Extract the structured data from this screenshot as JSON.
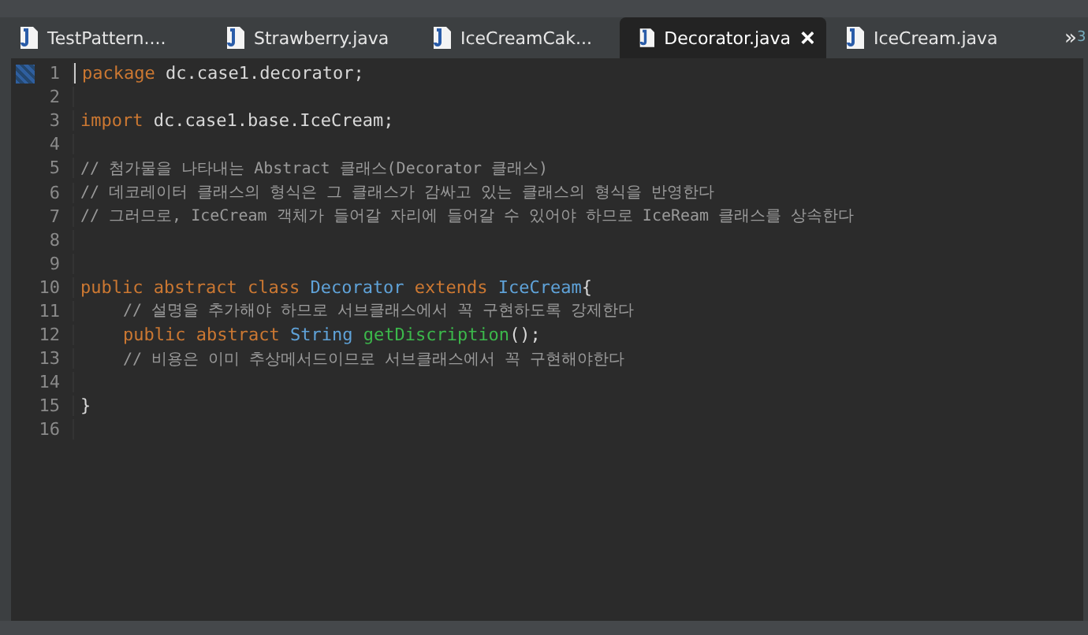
{
  "tabs": [
    {
      "label": "TestPattern....",
      "selected": false
    },
    {
      "label": "Strawberry.java",
      "selected": false
    },
    {
      "label": "IceCreamCak...",
      "selected": false
    },
    {
      "label": "Decorator.java",
      "selected": true
    },
    {
      "label": "IceCream.java",
      "selected": false
    }
  ],
  "overflow": {
    "glyph": "»",
    "count": "3"
  },
  "editor": {
    "lines": [
      {
        "number": "1",
        "current": true,
        "tokens": [
          {
            "kind": "keyword",
            "text": "package"
          },
          {
            "kind": "plain",
            "text": " dc.case1.decorator;"
          }
        ]
      },
      {
        "number": "2",
        "current": false
      },
      {
        "number": "3",
        "current": false,
        "tokens": [
          {
            "kind": "keyword",
            "text": "import"
          },
          {
            "kind": "plain",
            "text": " dc.case1.base.IceCream;"
          }
        ]
      },
      {
        "number": "4",
        "current": false
      },
      {
        "number": "5",
        "current": false,
        "tokens": [
          {
            "kind": "comment",
            "text": "// 첨가물을 나타내는 Abstract 클래스(Decorator 클래스)"
          }
        ]
      },
      {
        "number": "6",
        "current": false,
        "tokens": [
          {
            "kind": "comment",
            "text": "// 데코레이터 클래스의 형식은 그 클래스가 감싸고 있는 클래스의 형식을 반영한다"
          }
        ]
      },
      {
        "number": "7",
        "current": false,
        "tokens": [
          {
            "kind": "comment",
            "text": "// 그러므로, IceCream 객체가 들어갈 자리에 들어갈 수 있어야 하므로 IceReam 클래스를 상속한다"
          }
        ]
      },
      {
        "number": "8",
        "current": false
      },
      {
        "number": "9",
        "current": false
      },
      {
        "number": "10",
        "current": false,
        "tokens": [
          {
            "kind": "keyword",
            "text": "public abstract class "
          },
          {
            "kind": "type",
            "text": "Decorator"
          },
          {
            "kind": "keyword",
            "text": " extends "
          },
          {
            "kind": "type",
            "text": "IceCream"
          },
          {
            "kind": "plain",
            "text": "{"
          }
        ],
        "children": [
          {
            "number": "11",
            "current": false,
            "tokens": [
              {
                "kind": "comment",
                "text": "// 설명을 추가해야 하므로 서브클래스에서 꼭 구현하도록 강제한다"
              }
            ]
          },
          {
            "number": "12",
            "current": false,
            "tokens": [
              {
                "kind": "keyword",
                "text": "public abstract "
              },
              {
                "kind": "type",
                "text": "String"
              },
              {
                "kind": "method",
                "text": " getDiscription"
              },
              {
                "kind": "plain",
                "text": "();"
              }
            ]
          },
          {
            "number": "13",
            "current": false,
            "tokens": [
              {
                "kind": "comment",
                "text": "// 비용은 이미 추상메서드이므로 서브클래스에서 꼭 구현해야한다"
              }
            ]
          },
          {
            "number": "14",
            "current": false
          }
        ]
      },
      {
        "number": "15",
        "current": false,
        "tokens": [
          {
            "kind": "plain",
            "text": "}"
          }
        ]
      },
      {
        "number": "16",
        "current": false
      }
    ]
  }
}
